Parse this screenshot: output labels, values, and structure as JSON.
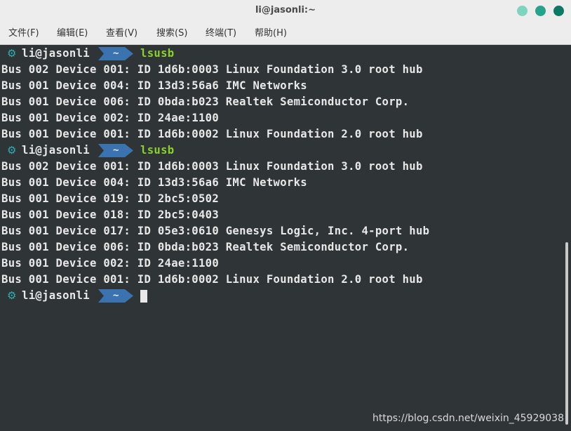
{
  "window": {
    "title": "li@jasonli:~",
    "buttons": [
      {
        "name": "minimize",
        "color": "#7fd4bf"
      },
      {
        "name": "maximize",
        "color": "#26a38a"
      },
      {
        "name": "close",
        "color": "#0c7a62"
      }
    ]
  },
  "menu": [
    "文件(F)",
    "编辑(E)",
    "查看(V)",
    "搜索(S)",
    "终端(T)",
    "帮助(H)"
  ],
  "prompt": {
    "icon": "gear-icon",
    "user_host": "li@jasonli",
    "cwd": "~"
  },
  "commands": [
    "lsusb",
    "lsusb"
  ],
  "output_block_1": [
    "Bus 002 Device 001: ID 1d6b:0003 Linux Foundation 3.0 root hub",
    "Bus 001 Device 004: ID 13d3:56a6 IMC Networks",
    "Bus 001 Device 006: ID 0bda:b023 Realtek Semiconductor Corp.",
    "Bus 001 Device 002: ID 24ae:1100",
    "Bus 001 Device 001: ID 1d6b:0002 Linux Foundation 2.0 root hub"
  ],
  "output_block_2": [
    "Bus 002 Device 001: ID 1d6b:0003 Linux Foundation 3.0 root hub",
    "Bus 001 Device 004: ID 13d3:56a6 IMC Networks",
    "Bus 001 Device 019: ID 2bc5:0502",
    "Bus 001 Device 018: ID 2bc5:0403",
    "Bus 001 Device 017: ID 05e3:0610 Genesys Logic, Inc. 4-port hub",
    "Bus 001 Device 006: ID 0bda:b023 Realtek Semiconductor Corp.",
    "Bus 001 Device 002: ID 24ae:1100",
    "Bus 001 Device 001: ID 1d6b:0002 Linux Foundation 2.0 root hub"
  ],
  "watermark": "https://blog.csdn.net/weixin_45929038",
  "colors": {
    "terminal_bg": "#2f3437",
    "prompt_arrow": "#3b73b0",
    "command": "#8bd12a",
    "gear": "#2fb1b1"
  }
}
